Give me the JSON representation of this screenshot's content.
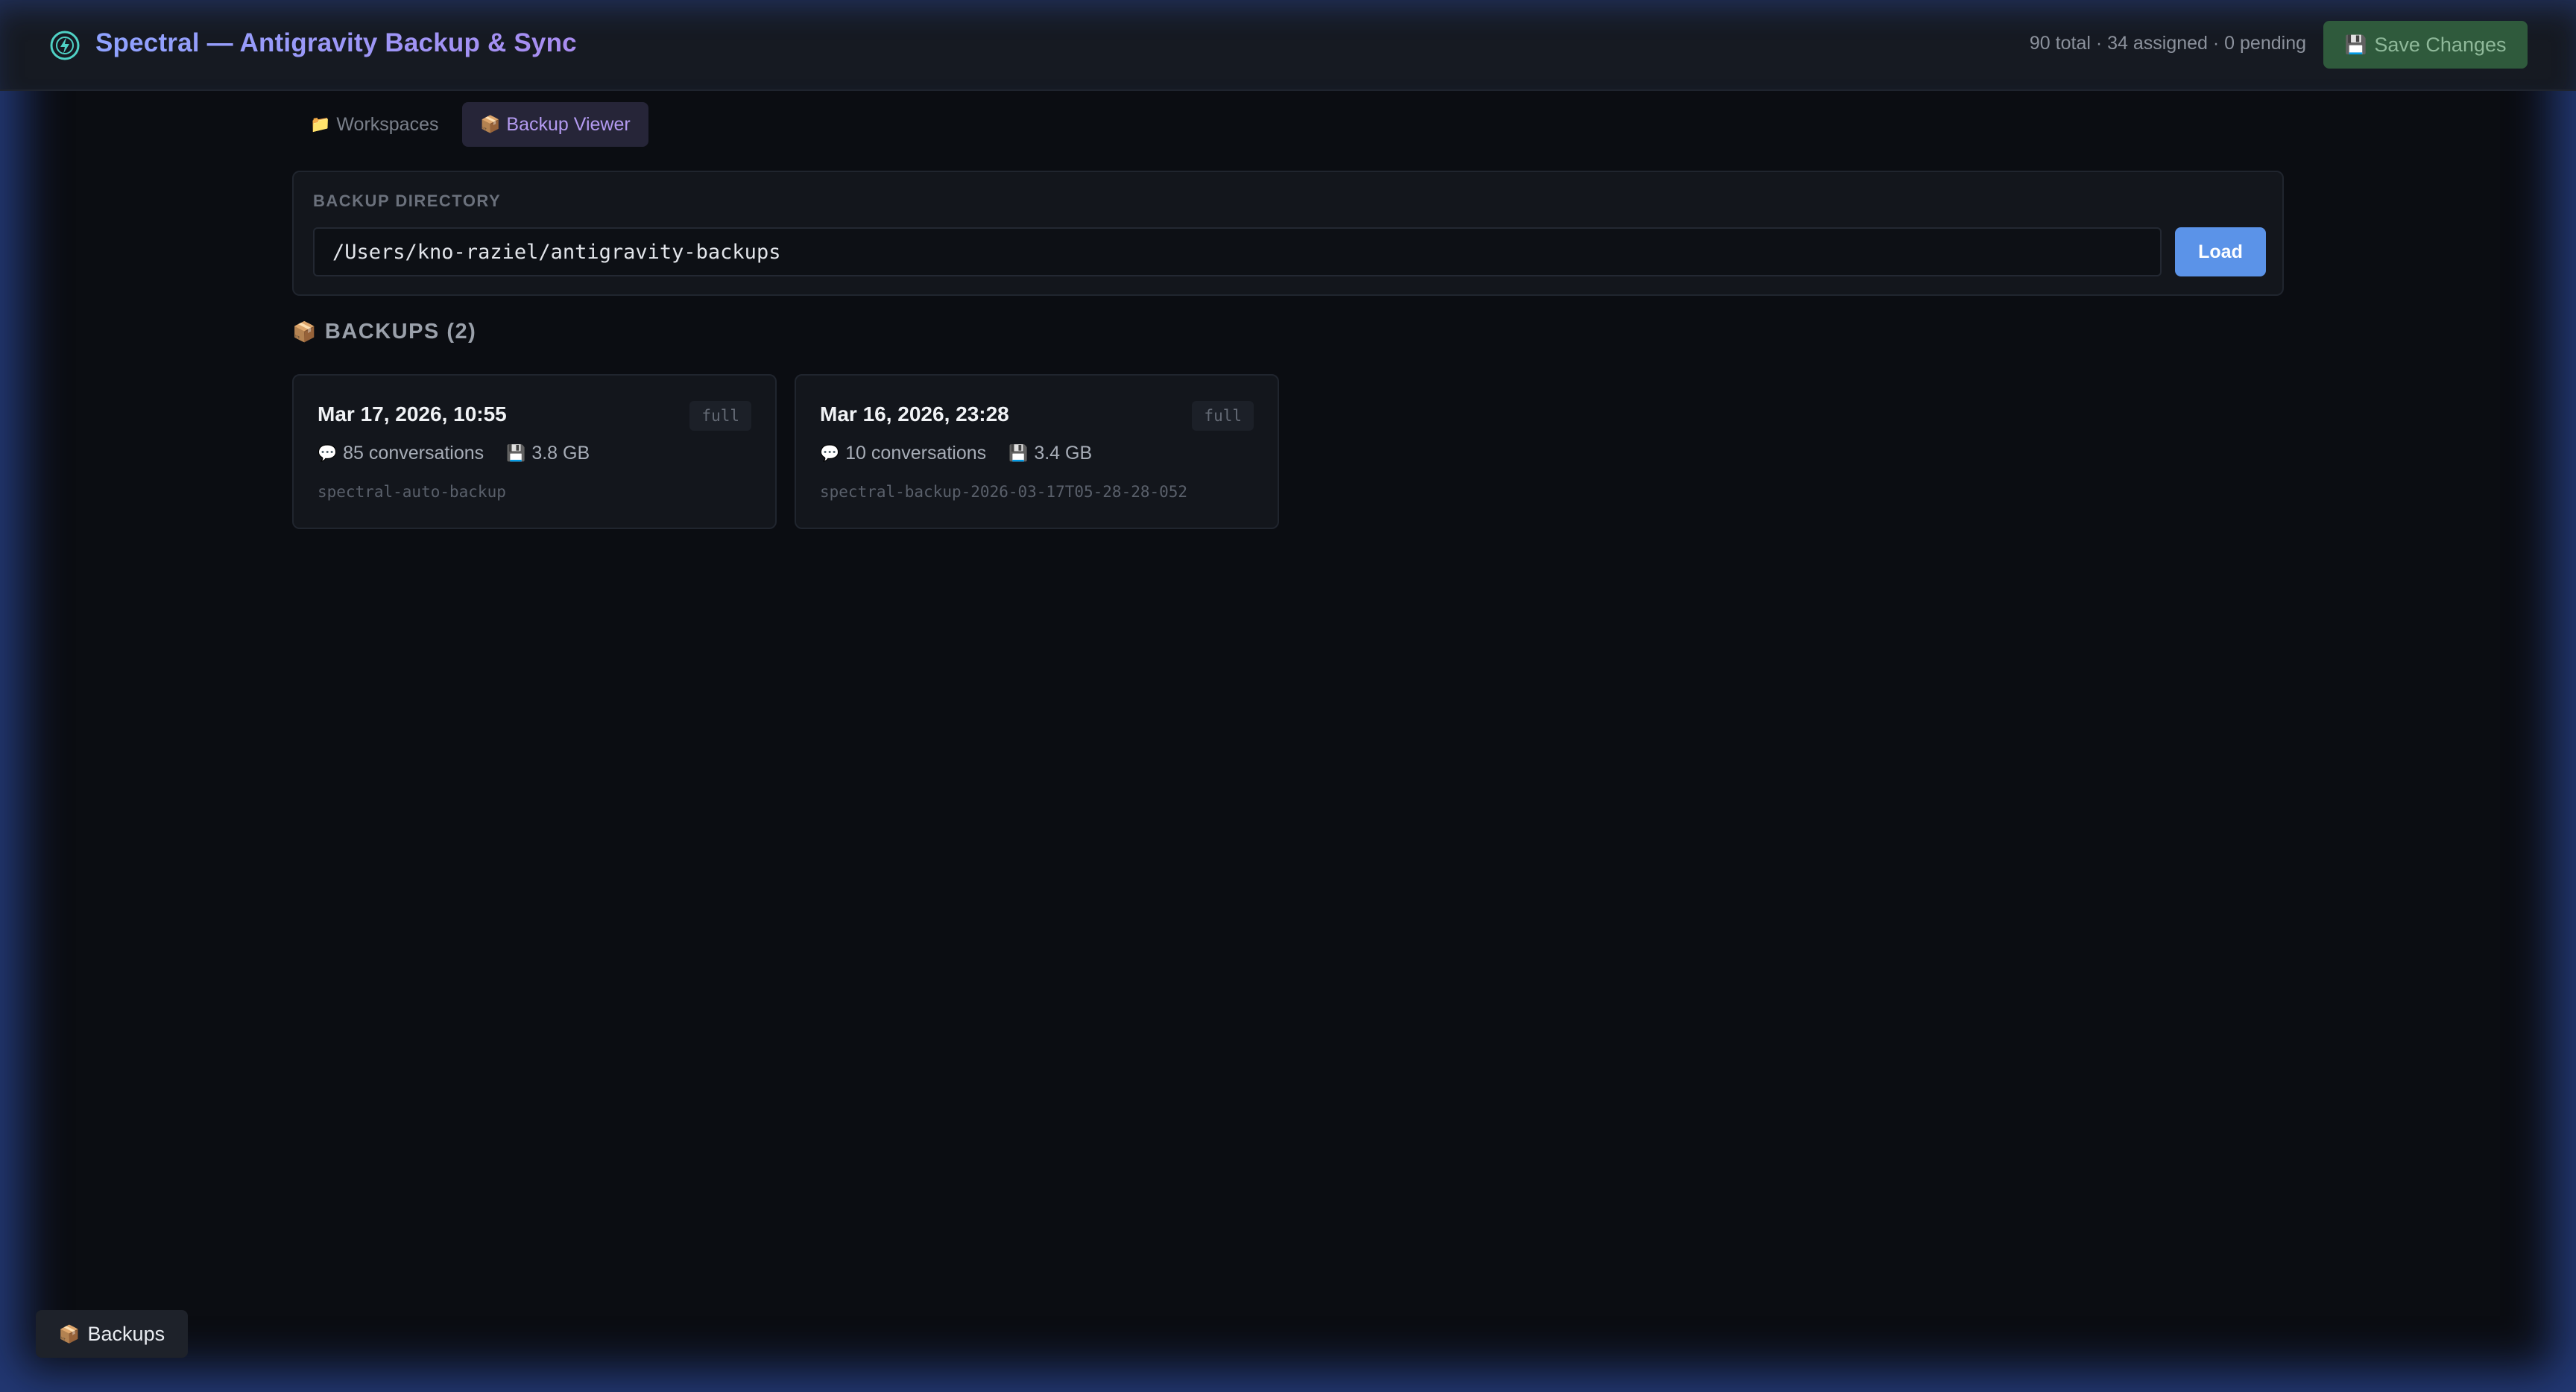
{
  "header": {
    "title": "Spectral — Antigravity Backup & Sync",
    "logo_icon": "lightning-bolt-icon",
    "stats": "90 total · 34 assigned · 0 pending",
    "save_label": "Save Changes",
    "save_icon": "💾"
  },
  "tabs": [
    {
      "label": "Workspaces",
      "icon": "📁",
      "active": false
    },
    {
      "label": "Backup Viewer",
      "icon": "📦",
      "active": true
    }
  ],
  "directory": {
    "label": "BACKUP DIRECTORY",
    "value": "/Users/kno-raziel/antigravity-backups",
    "load_label": "Load"
  },
  "backups_section": {
    "icon": "📦",
    "title": "BACKUPS (2)"
  },
  "backups": [
    {
      "date": "Mar 17, 2026, 10:55",
      "badge": "full",
      "conversations": "85 conversations",
      "size": "3.8 GB",
      "name": "spectral-auto-backup"
    },
    {
      "date": "Mar 16, 2026, 23:28",
      "badge": "full",
      "conversations": "10 conversations",
      "size": "3.4 GB",
      "name": "spectral-backup-2026-03-17T05-28-28-052"
    }
  ],
  "icons": {
    "conversations": "💬",
    "size": "💾"
  },
  "bottom_pill": {
    "icon": "📦",
    "label": "Backups"
  },
  "colors": {
    "accent": "#8fa3ff",
    "load_button": "#5b93e8",
    "save_button": "#2f5a3c",
    "background": "#0b0d12"
  }
}
